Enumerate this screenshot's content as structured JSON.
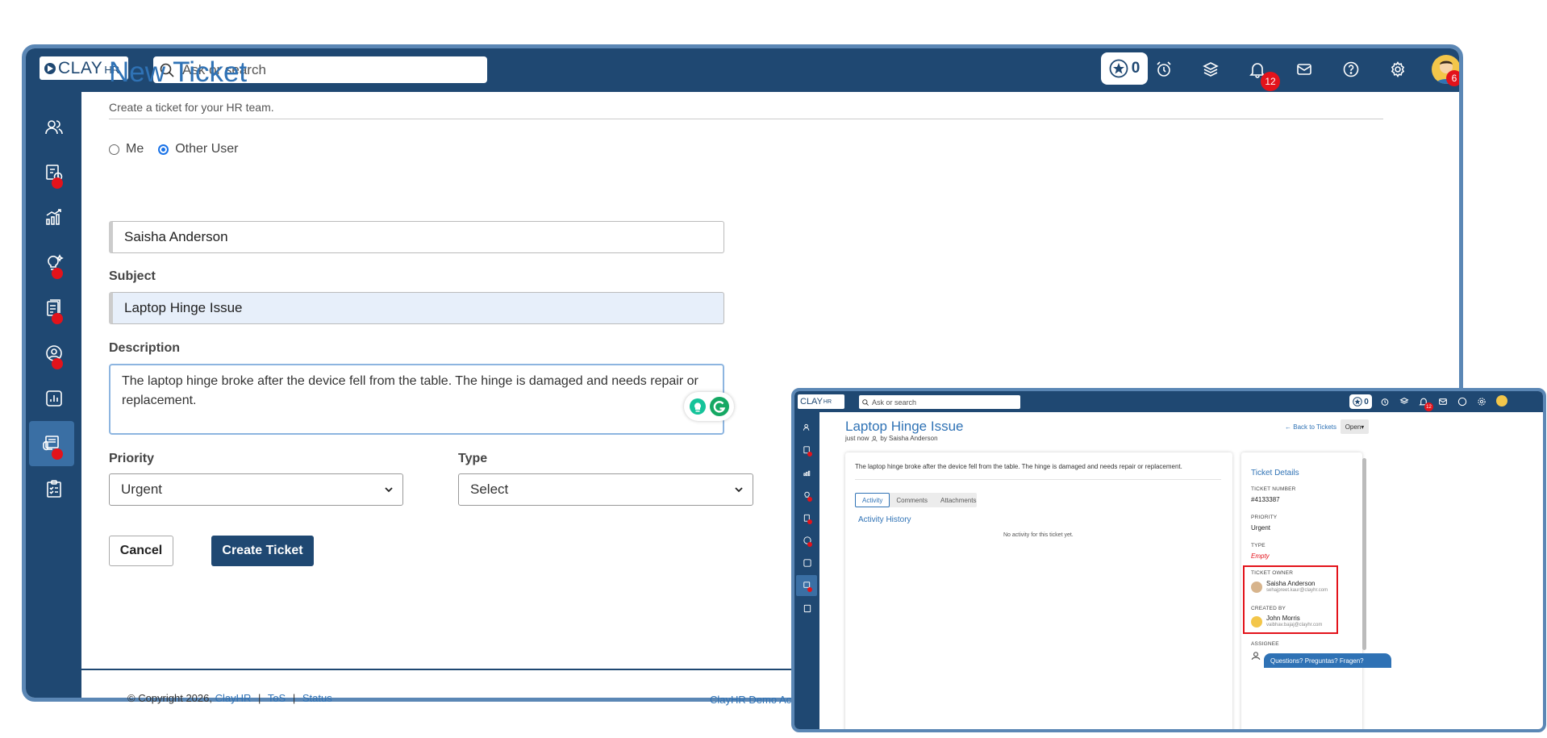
{
  "app": {
    "logo_text": "CLAY",
    "logo_suffix": "HR",
    "search_placeholder": "Ask or search"
  },
  "header": {
    "points": "0",
    "notifications_badge": "12",
    "avatar_badge": "6",
    "icons": [
      "star-icon",
      "alarm-icon",
      "layers-icon",
      "bell-icon",
      "mail-icon",
      "help-icon",
      "gear-icon"
    ]
  },
  "sidebar": {
    "items": [
      {
        "icon": "people-icon",
        "dot": false
      },
      {
        "icon": "time-report-icon",
        "dot": true
      },
      {
        "icon": "growth-chart-icon",
        "dot": false
      },
      {
        "icon": "ideas-icon",
        "dot": true
      },
      {
        "icon": "documents-icon",
        "dot": true
      },
      {
        "icon": "profile-icon",
        "dot": true
      },
      {
        "icon": "analytics-icon",
        "dot": false
      },
      {
        "icon": "helpdesk-icon",
        "dot": true,
        "active": true
      },
      {
        "icon": "checklist-icon",
        "dot": false
      }
    ]
  },
  "form": {
    "title": "New Ticket",
    "subtitle": "Create a ticket for your HR team.",
    "radio_me": "Me",
    "radio_other": "Other User",
    "selected_user": "Saisha Anderson",
    "subject_label": "Subject",
    "subject_value": "Laptop Hinge Issue",
    "description_label": "Description",
    "description_value": "The laptop hinge broke after the device fell from the table. The hinge is damaged and needs repair or replacement.",
    "priority_label": "Priority",
    "priority_value": "Urgent",
    "type_label": "Type",
    "type_value": "Select",
    "cancel": "Cancel",
    "create": "Create Ticket"
  },
  "footer": {
    "copyright": "© Copyright 2026,",
    "company": "ClayHR",
    "sep": "|",
    "tos": "ToS",
    "status": "Status",
    "demo": "ClayHR Demo Ac"
  },
  "inset": {
    "logo_text": "CLAY",
    "logo_suffix": "HR",
    "search_placeholder": "Ask or search",
    "points": "0",
    "notifications_badge": "12",
    "title": "Laptop Hinge Issue",
    "meta_time": "just now",
    "meta_by": "by Saisha Anderson",
    "back": "Back to Tickets",
    "status": "Open",
    "description": "The laptop hinge broke after the device fell from the table. The hinge is damaged and needs repair or replacement.",
    "tabs": [
      "Activity",
      "Comments",
      "Attachments"
    ],
    "activity_heading": "Activity History",
    "no_activity": "No activity for this ticket yet.",
    "details_heading": "Ticket Details",
    "ticket_number_label": "TICKET NUMBER",
    "ticket_number": "#4133387",
    "priority_label": "PRIORITY",
    "priority": "Urgent",
    "type_label": "TYPE",
    "type": "Empty",
    "owner_label": "TICKET OWNER",
    "owner_name": "Saisha Anderson",
    "owner_email": "sehajpreet.kaur@clayhr.com",
    "created_label": "CREATED BY",
    "created_name": "John Morris",
    "created_email": "vaibhav.bajaj@clayhr.com",
    "assignee_label": "ASSIGNEE",
    "questions": "Questions? Preguntas? Fragen?"
  }
}
